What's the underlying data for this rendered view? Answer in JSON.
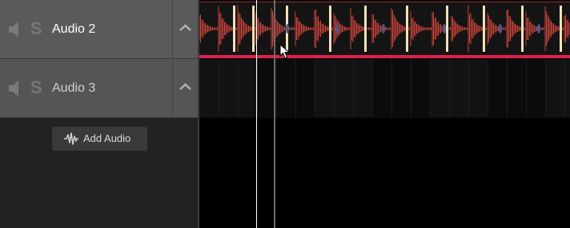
{
  "tracks": [
    {
      "name": "Audio 2",
      "solo_label": "S",
      "has_clip": true
    },
    {
      "name": "Audio 3",
      "solo_label": "S",
      "has_clip": false
    }
  ],
  "add_audio": {
    "label": "Add Audio"
  },
  "colors": {
    "selection_bar": "#e0204a",
    "waveform_red": "#c9443a",
    "waveform_cream": "#f0e2b8",
    "waveform_blue": "#4a5c8a"
  }
}
